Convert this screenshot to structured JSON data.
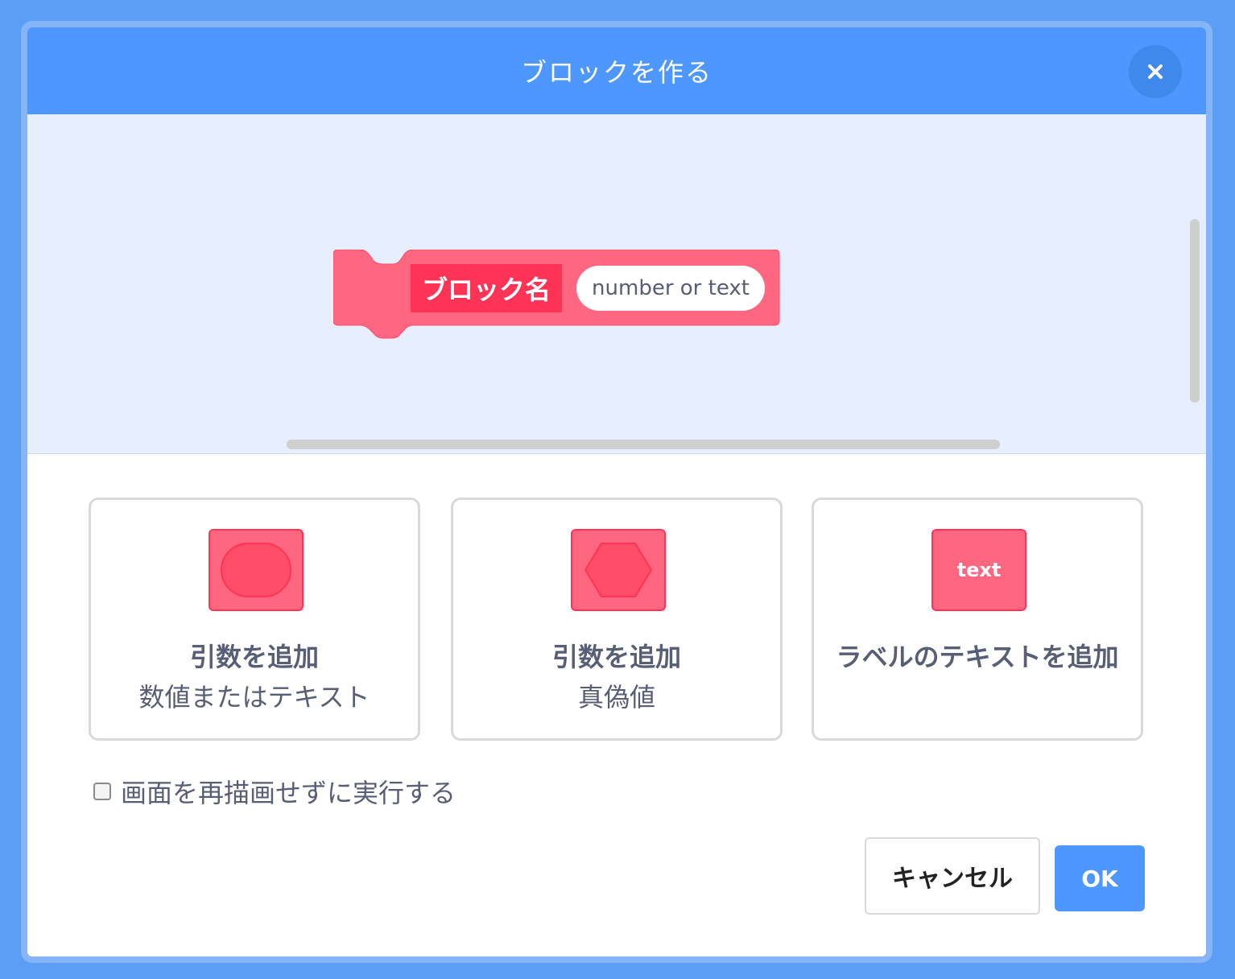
{
  "dialog": {
    "title": "ブロックを作る",
    "close_icon": "close-icon"
  },
  "preview_block": {
    "name_label": "ブロック名",
    "argument_label": "number or text",
    "fill_color": "#ff6680",
    "name_color": "#ff3355"
  },
  "options": [
    {
      "icon": "round-input-icon",
      "label": "引数を追加",
      "sublabel": "数値またはテキスト"
    },
    {
      "icon": "boolean-input-icon",
      "label": "引数を追加",
      "sublabel": "真偽値"
    },
    {
      "icon": "label-text-icon",
      "icon_text": "text",
      "label": "ラベルのテキストを追加",
      "sublabel": ""
    }
  ],
  "run_without_refresh": {
    "label": "画面を再描画せずに実行する",
    "checked": false
  },
  "buttons": {
    "cancel_label": "キャンセル",
    "ok_label": "OK"
  },
  "colors": {
    "header": "#4d97ff",
    "workspace": "#e7eefe",
    "accent": "#ff6680"
  }
}
